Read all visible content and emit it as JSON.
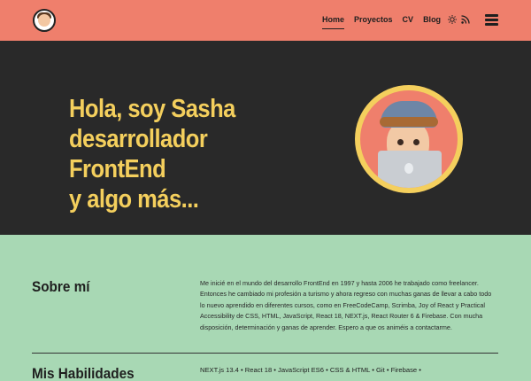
{
  "header": {
    "nav": [
      {
        "label": "Home",
        "active": true
      },
      {
        "label": "Proyectos",
        "active": false
      },
      {
        "label": "CV",
        "active": false
      },
      {
        "label": "Blog",
        "active": false
      }
    ],
    "colors": {
      "background": "#ef7f6c",
      "text": "#1f1f1f"
    },
    "icons": [
      "avatar-logo",
      "sun-icon",
      "rss-icon",
      "menu-icon"
    ]
  },
  "hero": {
    "title_lines": [
      "Hola, soy Sasha",
      "desarrollador FrontEnd",
      "y algo más..."
    ],
    "colors": {
      "background": "#292929",
      "title": "#f4cf5d",
      "avatar_border": "#f4cf5d",
      "avatar_bg": "#ef7f6c"
    }
  },
  "about": {
    "title": "Sobre mí",
    "text": "Me inicié en el mundo del desarrollo FrontEnd en 1997 y hasta 2006 he trabajado como freelancer. Entonces he cambiado mi profesión a turismo y ahora regreso con muchas ganas de llevar a cabo todo lo nuevo aprendido en diferentes cursos, como en FreeCodeCamp, Scrimba, Joy of React y Practical Accessibility de CSS, HTML, JavaScript, React 18, NEXT.js, React Router 6 & Firebase. Con mucha disposición, determinación y ganas de aprender. Espero a que os animéis a contactarme."
  },
  "skills": {
    "title": "Mis Habilidades",
    "text": "NEXT.js 13.4 • React 18 • JavaScript ES6 • CSS & HTML • Git • Firebase •"
  },
  "page": {
    "background": "#a8d8b4"
  }
}
